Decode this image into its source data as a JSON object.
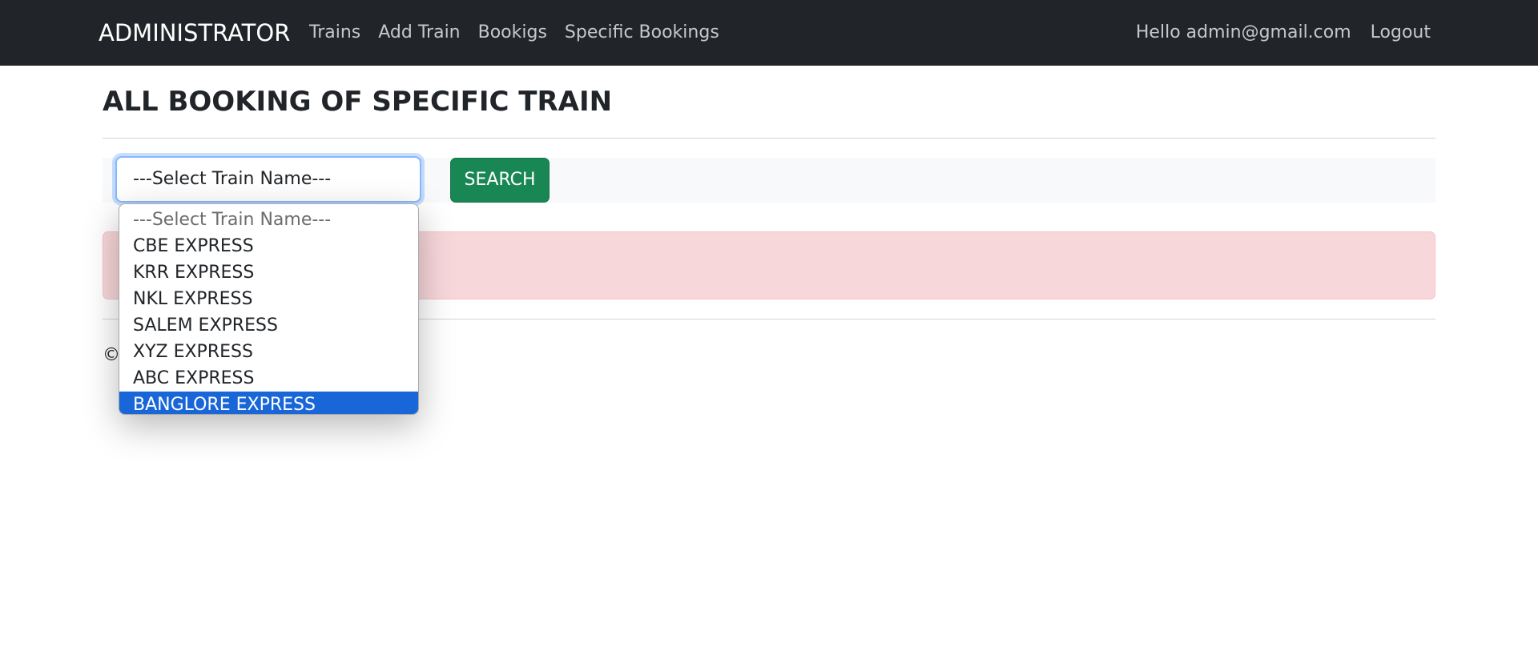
{
  "navbar": {
    "brand": "ADMINISTRATOR",
    "links": [
      "Trains",
      "Add Train",
      "Bookigs",
      "Specific Bookings"
    ],
    "greeting": "Hello admin@gmail.com",
    "logout": "Logout"
  },
  "page": {
    "title": "ALL BOOKING OF SPECIFIC TRAIN"
  },
  "search": {
    "select_value": "---Select Train Name---",
    "button_label": "SEARCH"
  },
  "dropdown": {
    "options": [
      "---Select Train Name---",
      "CBE EXPRESS",
      "KRR EXPRESS",
      "NKL EXPRESS",
      "SALEM EXPRESS",
      "XYZ EXPRESS",
      "ABC EXPRESS",
      "BANGLORE EXPRESS"
    ],
    "highlighted": "BANGLORE EXPRESS"
  },
  "footer": {
    "text": "©"
  },
  "colors": {
    "navbar_bg": "#212529",
    "search_button": "#198754",
    "alert_bg": "#f8d7da",
    "option_highlight": "#1866d8"
  }
}
